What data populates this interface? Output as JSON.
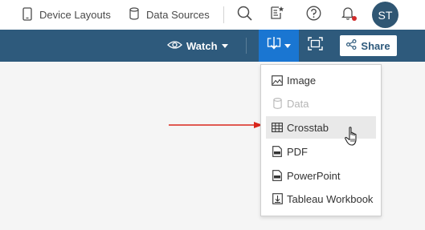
{
  "topbar": {
    "device_layouts_label": "Device Layouts",
    "data_sources_label": "Data Sources",
    "avatar_initials": "ST",
    "icons": [
      "tablet-icon",
      "database-icon",
      "search-icon",
      "custom-views-icon",
      "help-icon",
      "bell-icon"
    ]
  },
  "toolbar": {
    "watch_label": "Watch",
    "share_label": "Share",
    "icons": [
      "eye-icon",
      "download-icon",
      "fullscreen-icon",
      "share-icon"
    ]
  },
  "download_menu": {
    "items": [
      {
        "label": "Image",
        "icon": "image-icon",
        "state": "enabled"
      },
      {
        "label": "Data",
        "icon": "database-icon",
        "state": "disabled"
      },
      {
        "label": "Crosstab",
        "icon": "table-icon",
        "state": "hovered"
      },
      {
        "label": "PDF",
        "icon": "pdf-icon",
        "state": "enabled"
      },
      {
        "label": "PowerPoint",
        "icon": "powerpoint-icon",
        "state": "enabled"
      },
      {
        "label": "Tableau Workbook",
        "icon": "workbook-icon",
        "state": "enabled"
      }
    ]
  },
  "annotation": {
    "arrow_color": "#d9261c",
    "points_to": "Crosstab"
  },
  "colors": {
    "toolbar_bg": "#2e5a7c",
    "download_active_bg": "#1a76d2",
    "avatar_bg": "#2f5673",
    "menu_hover_bg": "#e9e9e9",
    "notification_dot": "#d12b2b"
  }
}
